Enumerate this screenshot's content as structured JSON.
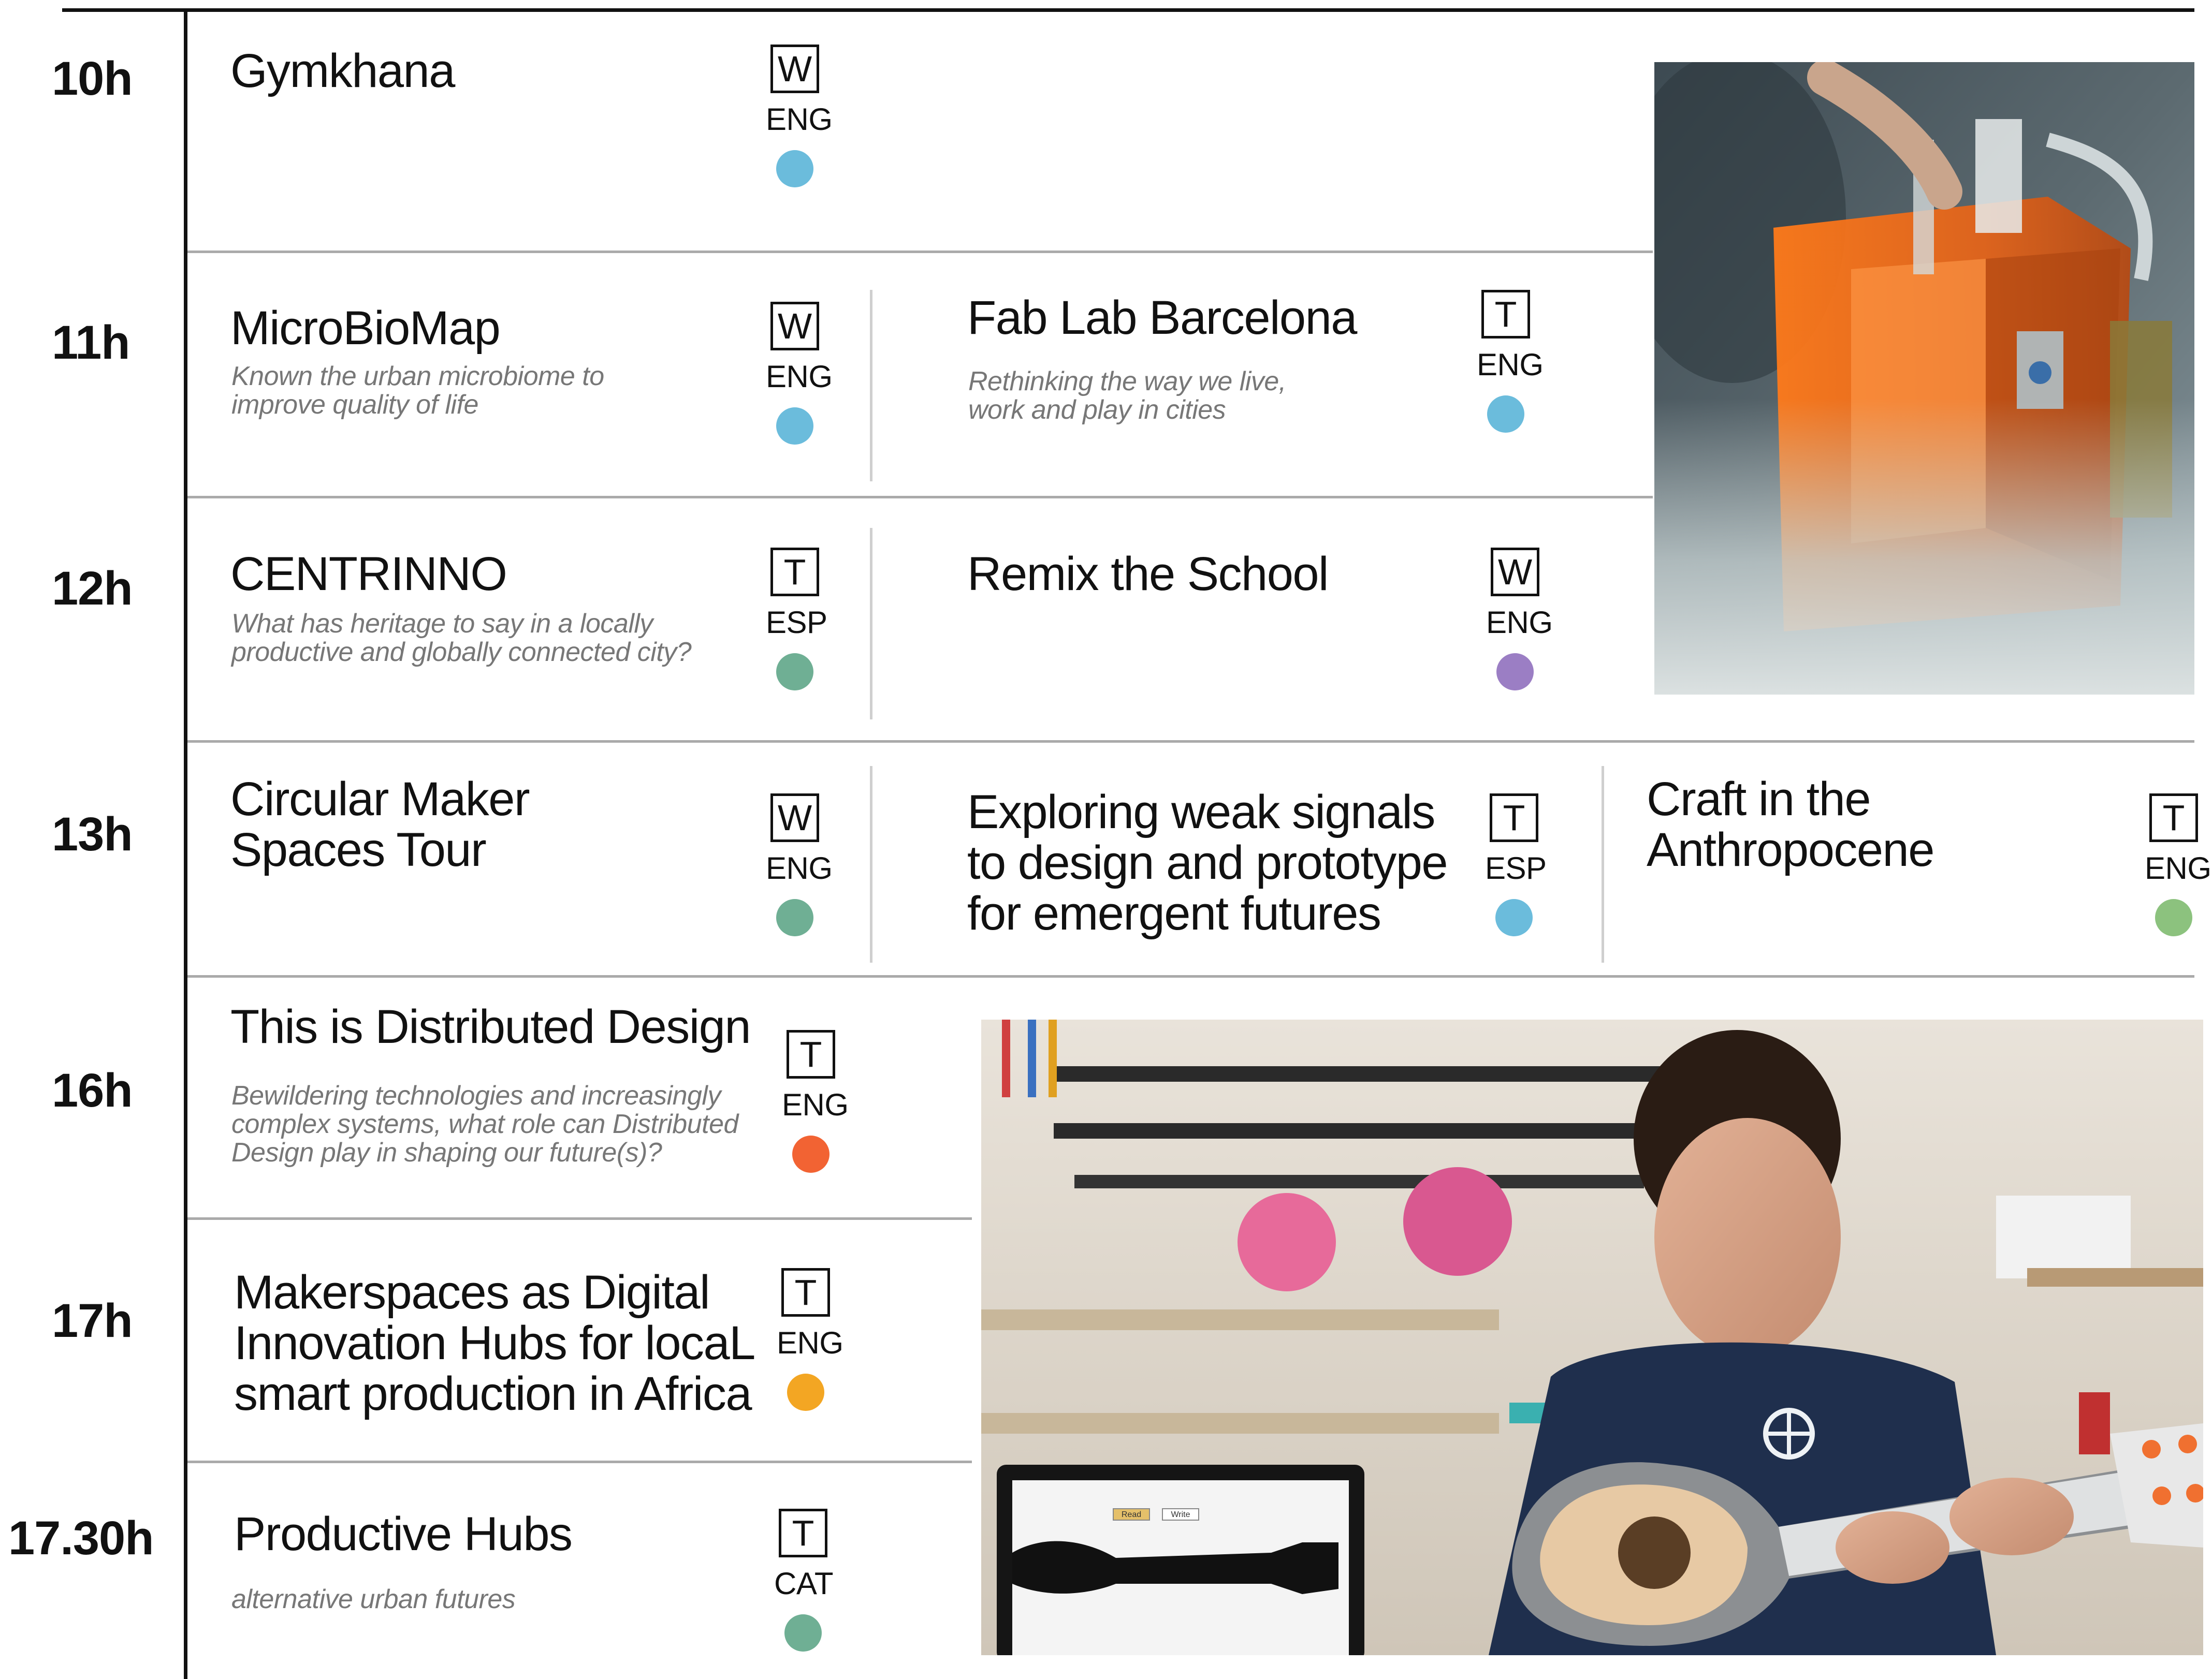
{
  "colors": {
    "blue": "#6bbcdc",
    "teal": "#6faf94",
    "purple": "#9b7ec4",
    "green": "#8cc27e",
    "red": "#f26333",
    "orange": "#f3a623"
  },
  "times": [
    "10h",
    "11h",
    "12h",
    "13h",
    "16h",
    "17h",
    "17.30h"
  ],
  "sessions": {
    "gymkhana": {
      "title": "Gymkhana",
      "type": "W",
      "lang": "ENG",
      "dot": "blue"
    },
    "microbiomap": {
      "title": "MicroBioMap",
      "subtitle": [
        "Known the urban microbiome to",
        "improve quality of life"
      ],
      "type": "W",
      "lang": "ENG",
      "dot": "blue"
    },
    "fablab": {
      "title": "Fab Lab Barcelona",
      "subtitle": [
        "Rethinking the way we live,",
        "work and play in cities"
      ],
      "type": "T",
      "lang": "ENG",
      "dot": "blue"
    },
    "centrinno": {
      "title": "CENTRINNO",
      "subtitle": [
        "What has heritage to say in a locally",
        "productive and globally connected city?"
      ],
      "type": "T",
      "lang": "ESP",
      "dot": "teal"
    },
    "remix": {
      "title": "Remix the School",
      "type": "W",
      "lang": "ENG",
      "dot": "purple"
    },
    "circular": {
      "title": [
        "Circular Maker",
        "Spaces Tour"
      ],
      "type": "W",
      "lang": "ENG",
      "dot": "teal"
    },
    "weak_signals": {
      "title": [
        "Exploring weak signals",
        "to design and prototype",
        "for emergent futures"
      ],
      "type": "T",
      "lang": "ESP",
      "dot": "blue"
    },
    "craft": {
      "title": [
        "Craft in the",
        "Anthropocene"
      ],
      "type": "T",
      "lang": "ENG",
      "dot": "green"
    },
    "distributed": {
      "title": "This is Distributed Design",
      "subtitle": [
        "Bewildering technologies and increasingly",
        "complex systems, what role can Distributed",
        "Design play in shaping our future(s)?"
      ],
      "type": "T",
      "lang": "ENG",
      "dot": "red"
    },
    "makerspaces": {
      "title": [
        "Makerspaces as Digital",
        "Innovation Hubs for locaL",
        "smart production in Africa"
      ],
      "type": "T",
      "lang": "ENG",
      "dot": "orange"
    },
    "productive": {
      "title": "Productive Hubs",
      "subtitle": [
        "alternative urban futures"
      ],
      "type": "T",
      "lang": "CAT",
      "dot": "teal"
    }
  },
  "photo_bottom": {
    "button_read": "Read",
    "button_write": "Write"
  }
}
